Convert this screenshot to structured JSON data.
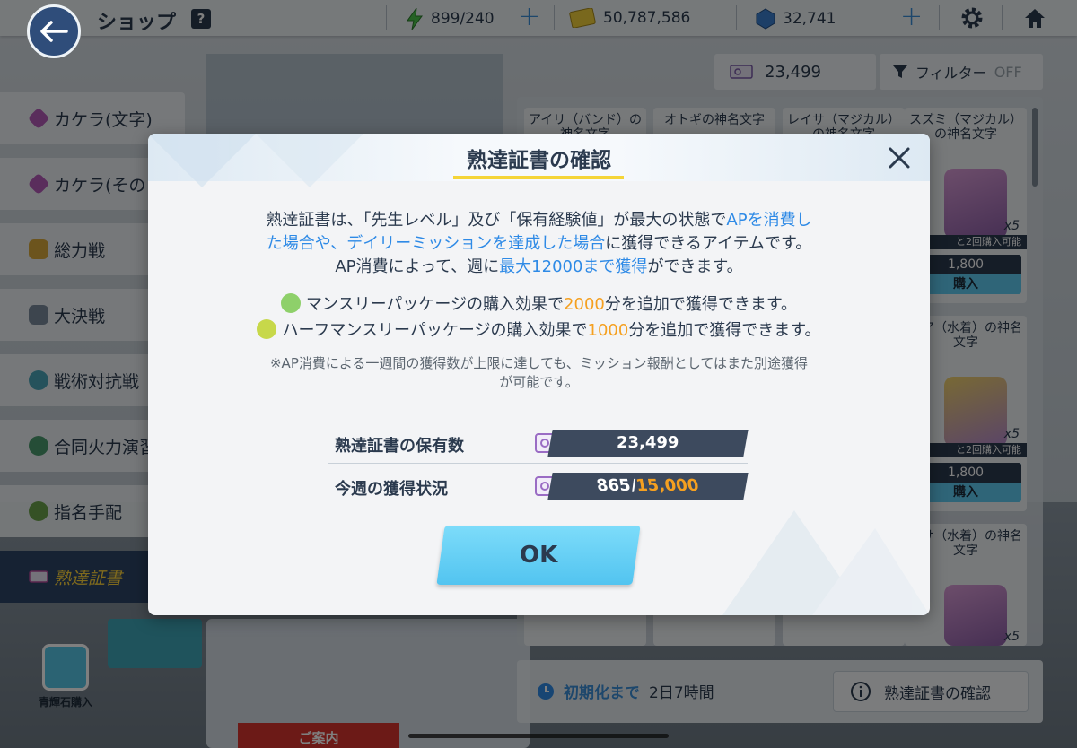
{
  "header": {
    "title": "ショップ",
    "help": "?",
    "ap": "899/240",
    "credits": "50,787,586",
    "pyroxene": "32,741"
  },
  "currency_bar": {
    "certificates": "23,499",
    "filter_label": "フィルター",
    "filter_state": "OFF"
  },
  "sidebar": {
    "items": [
      {
        "label": "カケラ(文字)",
        "color": "#b45ab8"
      },
      {
        "label": "カケラ(その",
        "color": "#b45ab8"
      },
      {
        "label": "総力戦",
        "color": "#d9a83a"
      },
      {
        "label": "大決戦",
        "color": "#7b8a9c"
      },
      {
        "label": "戦術対抗戦",
        "color": "#4aa5b8"
      },
      {
        "label": "合同火力演習",
        "color": "#4a9a6e"
      },
      {
        "label": "指名手配",
        "color": "#6aa24a"
      },
      {
        "label": "熟達証書",
        "color": "#ffd43a"
      }
    ],
    "bluestone_label": "青輝石購入"
  },
  "shop": {
    "cards": [
      {
        "name": "アイリ（バンド）の神名文字"
      },
      {
        "name": "オトギの神名文字"
      },
      {
        "name": "レイサ（マジカル）の神名文字"
      },
      {
        "name": "スズミ（マジカル）の神名文字",
        "count": "x5",
        "limit": "と2回購入可能",
        "price": "1,800",
        "buy": "購入"
      },
      {
        "name": "イア（水着）の神名文字",
        "count": "x5",
        "limit": "と2回購入可能",
        "price": "1,800",
        "buy": "購入"
      },
      {
        "name": "ギサ（水着）の神名文字",
        "count": "x5"
      }
    ]
  },
  "bottom": {
    "reset_label": "初期化まで",
    "reset_time": "2日7時間",
    "confirm_label": "熟達証書の確認"
  },
  "modal": {
    "title": "熟達証書の確認",
    "line1_a": "熟達証書は、「先生レベル」及び「保有経験値」が最大の状態で",
    "line1_b": "APを消費し",
    "line2_a": "た場合や、デイリーミッションを達成した場合",
    "line2_b": "に獲得できるアイテムです。",
    "line3_a": "AP消費によって、週に",
    "line3_b": "最大12000まで獲得",
    "line3_c": "ができます。",
    "bonus1_a": "マンスリーパッケージの購入効果で",
    "bonus1_b": "2000",
    "bonus1_c": "分を追加で獲得できます。",
    "bonus2_a": "ハーフマンスリーパッケージの購入効果で",
    "bonus2_b": "1000",
    "bonus2_c": "分を追加で獲得できます。",
    "note1": "※AP消費による一週間の獲得数が上限に達しても、ミッション報酬としてはまた別途獲得",
    "note2": "が可能です。",
    "held_label": "熟達証書の保有数",
    "held_value": "23,499",
    "weekly_label": "今週の獲得状況",
    "weekly_current": "865",
    "weekly_slash": "/",
    "weekly_max": "15,000",
    "ok": "OK"
  }
}
